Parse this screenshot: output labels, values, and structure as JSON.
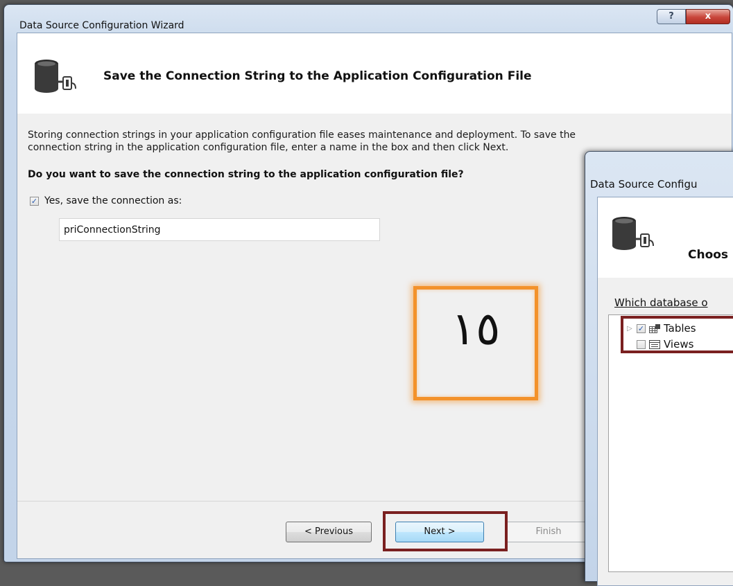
{
  "back_window": {
    "title": "Data Source Configuration Wizard",
    "help_glyph": "?",
    "close_glyph": "x",
    "heading": "Save the Connection String to the Application Configuration File",
    "description_line1": "Storing connection strings in your application configuration file eases maintenance and deployment. To save the",
    "description_line2": "connection string in the application configuration file, enter a name in the box and then click Next.",
    "question": "Do you want to save the connection string to the application configuration file?",
    "save_checkbox": {
      "label": "Yes, save the connection as:",
      "checked": true,
      "glyph": "✓"
    },
    "connection_name": "priConnectionString",
    "buttons": {
      "previous": "< Previous",
      "next": "Next >",
      "finish": "Finish"
    }
  },
  "annotation": {
    "step_number": "١٥",
    "color": "#f3922b"
  },
  "highlight_color": "#7a2020",
  "front_window": {
    "title": "Data Source Configu",
    "heading": "Choos",
    "prompt": "Which database o",
    "tree": [
      {
        "label": "Tables",
        "checked": true,
        "icon": "table-icon",
        "expander": "▷",
        "glyph": "✓"
      },
      {
        "label": "Views",
        "checked": false,
        "icon": "view-icon",
        "expander": "",
        "glyph": ""
      }
    ]
  }
}
